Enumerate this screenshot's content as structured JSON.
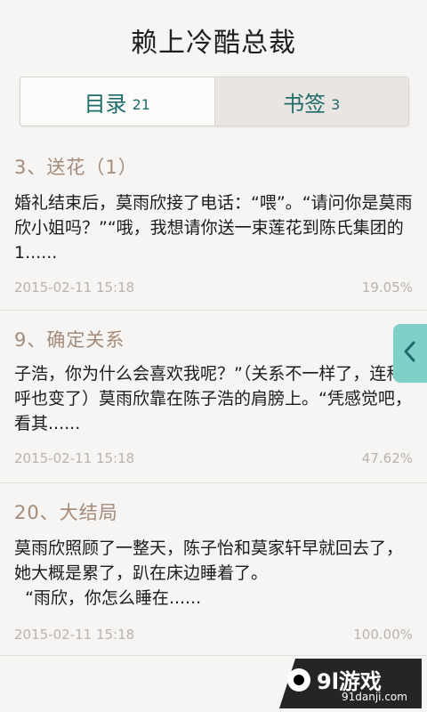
{
  "header": {
    "title": "赖上冷酷总裁"
  },
  "tabs": [
    {
      "label": "目录",
      "count": "21"
    },
    {
      "label": "书签",
      "count": "3"
    }
  ],
  "bookmarks": [
    {
      "title": "3、送花（1）",
      "excerpt": "婚礼结束后，莫雨欣接了电话：“喂”。“请问你是莫雨欣小姐吗？”“哦，我想请你送一束莲花到陈氏集团的1......",
      "time": "2015-02-11  15:18",
      "progress": "19.05%"
    },
    {
      "title": "9、确定关系",
      "excerpt": "子浩，你为什么会喜欢我呢？”（关系不一样了，连称呼也变了）莫雨欣靠在陈子浩的肩膀上。“凭感觉吧，看其......",
      "time": "2015-02-11  15:18",
      "progress": "47.62%"
    },
    {
      "title": "20、大结局",
      "excerpt": "莫雨欣照顾了一整天，陈子怡和莫家轩早就回去了，她大概是累了，趴在床边睡着了。\n  “雨欣，你怎么睡在......",
      "time": "2015-02-11  15:18",
      "progress": "100.00%"
    }
  ],
  "side_tab": {
    "icon": "chevron-left-icon",
    "color": "#7fd0c8"
  },
  "watermark": {
    "logo_text": "9l游戏",
    "sub_text": "91danji.com"
  },
  "colors": {
    "accent": "#1f6b6b",
    "chapter_title": "#a48a78",
    "meta": "#b8b3ad"
  }
}
